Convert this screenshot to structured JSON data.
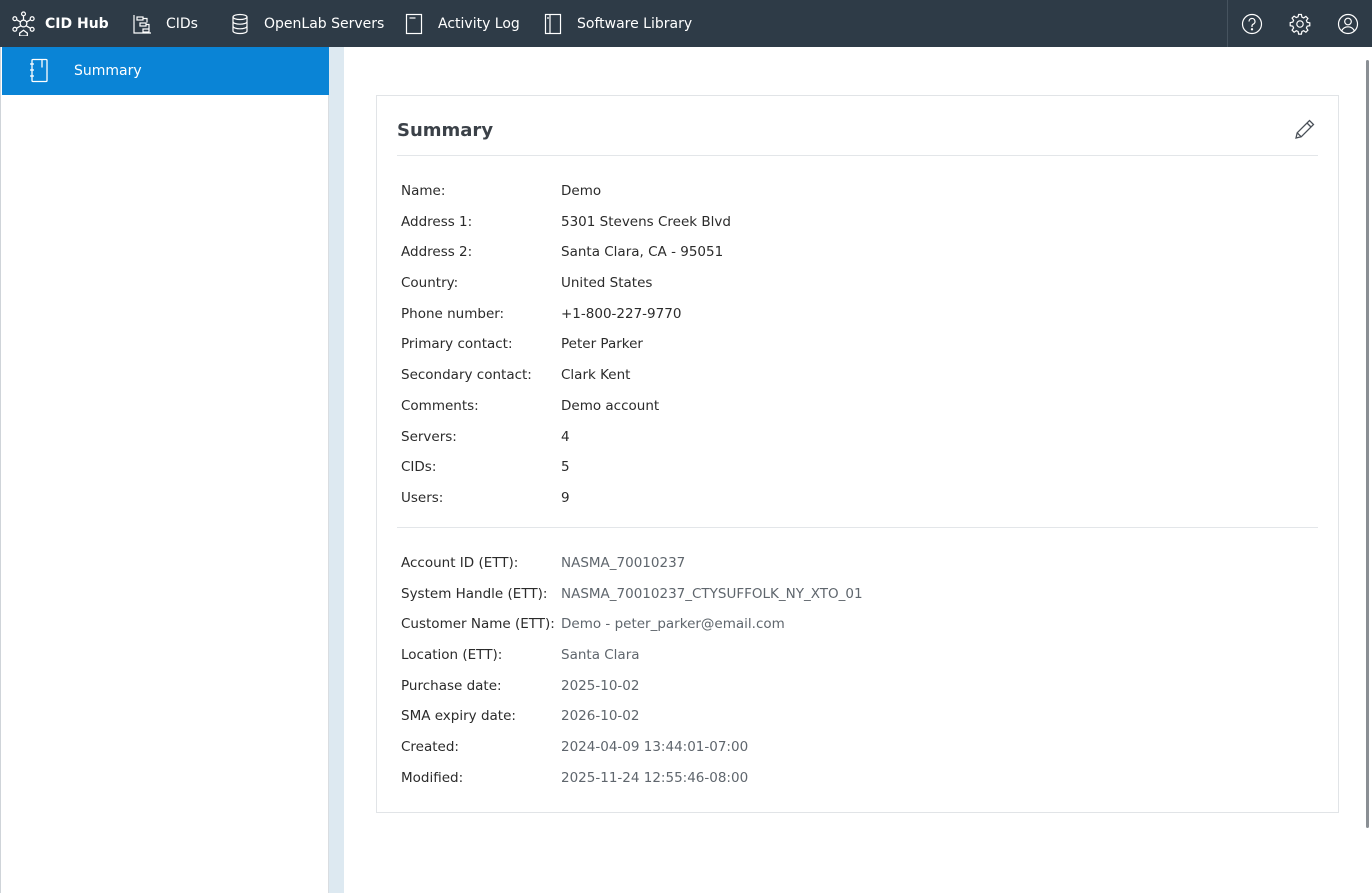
{
  "nav": {
    "brand": "CID Hub",
    "items": [
      {
        "label": "CIDs",
        "icon": "cids-icon"
      },
      {
        "label": "OpenLab Servers",
        "icon": "database-icon"
      },
      {
        "label": "Activity Log",
        "icon": "document-icon"
      },
      {
        "label": "Software Library",
        "icon": "book-icon"
      }
    ],
    "tools": [
      "help-icon",
      "gear-icon",
      "user-icon"
    ]
  },
  "sidebar": {
    "items": [
      {
        "label": "Summary",
        "icon": "notebook-icon",
        "active": true
      }
    ]
  },
  "card": {
    "title": "Summary",
    "fields": [
      {
        "key": "Name:",
        "value": "Demo"
      },
      {
        "key": "Address 1:",
        "value": "5301 Stevens Creek Blvd"
      },
      {
        "key": "Address 2:",
        "value": "Santa Clara, CA - 95051"
      },
      {
        "key": "Country:",
        "value": "United States"
      },
      {
        "key": "Phone number:",
        "value": "+1-800-227-9770"
      },
      {
        "key": "Primary contact:",
        "value": "Peter Parker"
      },
      {
        "key": "Secondary contact:",
        "value": "Clark Kent"
      },
      {
        "key": "Comments:",
        "value": "Demo account"
      },
      {
        "key": "Servers:",
        "value": "4"
      },
      {
        "key": "CIDs:",
        "value": "5"
      },
      {
        "key": "Users:",
        "value": "9"
      }
    ],
    "ett_fields": [
      {
        "key": "Account ID (ETT):",
        "value": "NASMA_70010237"
      },
      {
        "key": "System Handle (ETT):",
        "value": "NASMA_70010237_CTYSUFFOLK_NY_XTO_01"
      },
      {
        "key": "Customer Name (ETT):",
        "value": "Demo - peter_parker@email.com"
      },
      {
        "key": "Location (ETT):",
        "value": "Santa Clara"
      },
      {
        "key": "Purchase date:",
        "value": "2025-10-02"
      },
      {
        "key": "SMA expiry date:",
        "value": "2026-10-02"
      },
      {
        "key": "Created:",
        "value": "2024-04-09 13:44:01-07:00"
      },
      {
        "key": "Modified:",
        "value": "2025-11-24 12:55:46-08:00"
      }
    ]
  },
  "colors": {
    "topbar": "#2e3b47",
    "accent": "#0a84d6"
  }
}
